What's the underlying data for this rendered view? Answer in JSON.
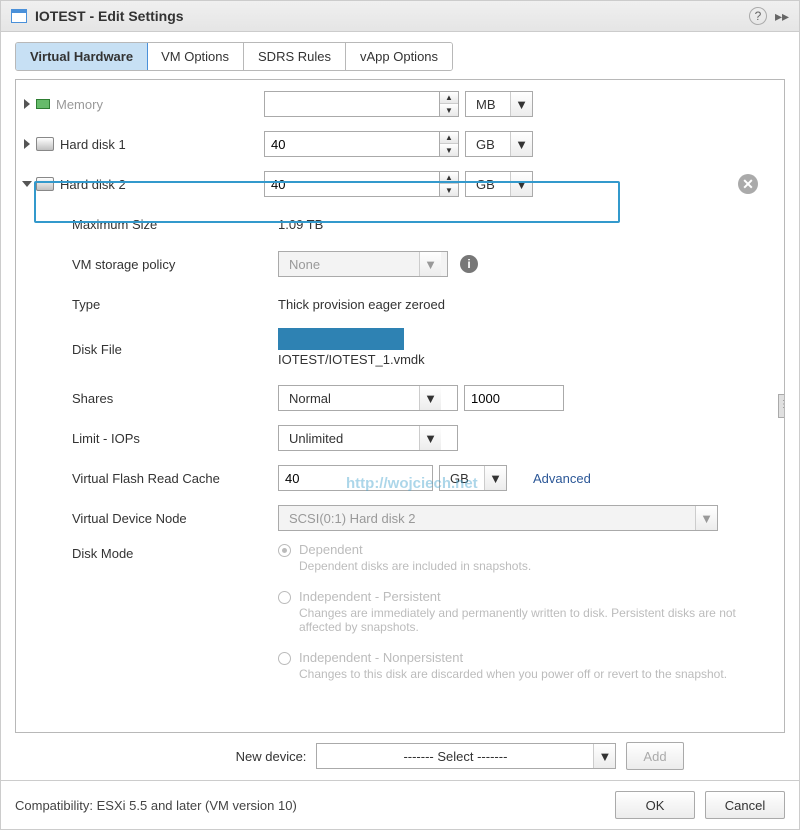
{
  "window": {
    "title": "IOTEST - Edit Settings"
  },
  "tabs": {
    "virtual_hardware": "Virtual Hardware",
    "vm_options": "VM Options",
    "sdrs_rules": "SDRS Rules",
    "vapp_options": "vApp Options"
  },
  "devices": {
    "memory": {
      "label": "Memory",
      "value": "",
      "unit": "MB"
    },
    "hd1": {
      "label": "Hard disk 1",
      "size": "40",
      "unit": "GB"
    },
    "hd2": {
      "label": "Hard disk 2",
      "size": "40",
      "unit": "GB",
      "max_size_label": "Maximum Size",
      "max_size_value": "1.09 TB",
      "storage_policy_label": "VM storage policy",
      "storage_policy_value": "None",
      "type_label": "Type",
      "type_value": "Thick provision eager zeroed",
      "disk_file_label": "Disk File",
      "disk_file_value": "IOTEST/IOTEST_1.vmdk",
      "shares_label": "Shares",
      "shares_preset": "Normal",
      "shares_value": "1000",
      "limit_iops_label": "Limit - IOPs",
      "limit_iops_value": "Unlimited",
      "vfrc_label": "Virtual Flash Read Cache",
      "vfrc_value": "40",
      "vfrc_unit": "GB",
      "vfrc_advanced": "Advanced",
      "vdn_label": "Virtual Device Node",
      "vdn_value": "SCSI(0:1) Hard disk 2",
      "disk_mode_label": "Disk Mode",
      "disk_mode_options": [
        {
          "title": "Dependent",
          "desc": "Dependent disks are included in snapshots.",
          "selected": true
        },
        {
          "title": "Independent - Persistent",
          "desc": "Changes are immediately and permanently written to disk. Persistent disks are not affected by snapshots.",
          "selected": false
        },
        {
          "title": "Independent - Nonpersistent",
          "desc": "Changes to this disk are discarded when you power off or revert to the snapshot.",
          "selected": false
        }
      ]
    }
  },
  "new_device": {
    "label": "New device:",
    "placeholder": "------- Select -------",
    "add": "Add"
  },
  "footer": {
    "compatibility": "Compatibility: ESXi 5.5 and later (VM version 10)",
    "ok": "OK",
    "cancel": "Cancel"
  },
  "watermark": "http://wojciech.net"
}
